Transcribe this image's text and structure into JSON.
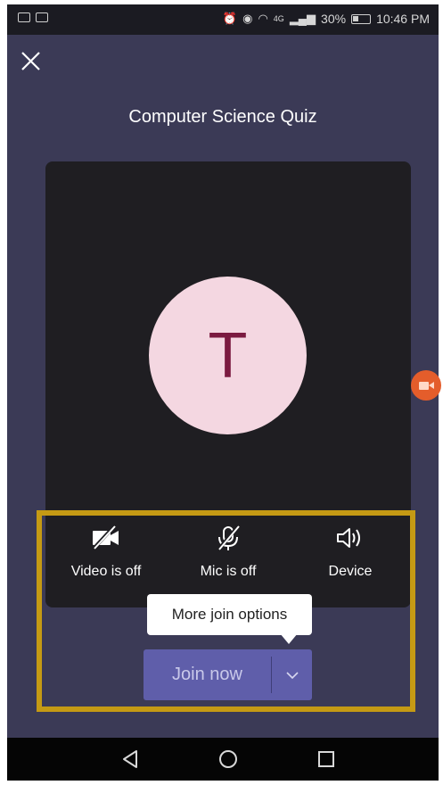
{
  "status_bar": {
    "network": "4G",
    "battery": "30%",
    "time": "10:46 PM"
  },
  "meeting": {
    "title": "Computer Science Quiz",
    "avatar_initial": "T"
  },
  "controls": {
    "video_label": "Video is off",
    "mic_label": "Mic is off",
    "device_label": "Device"
  },
  "tooltip": {
    "text": "More join options"
  },
  "join": {
    "label": "Join now"
  },
  "colors": {
    "background": "#3b3a56",
    "join_button": "#5f5eaa",
    "avatar_bg": "#f4d7e1",
    "avatar_text": "#7b1a40",
    "highlight": "#c59a14"
  }
}
